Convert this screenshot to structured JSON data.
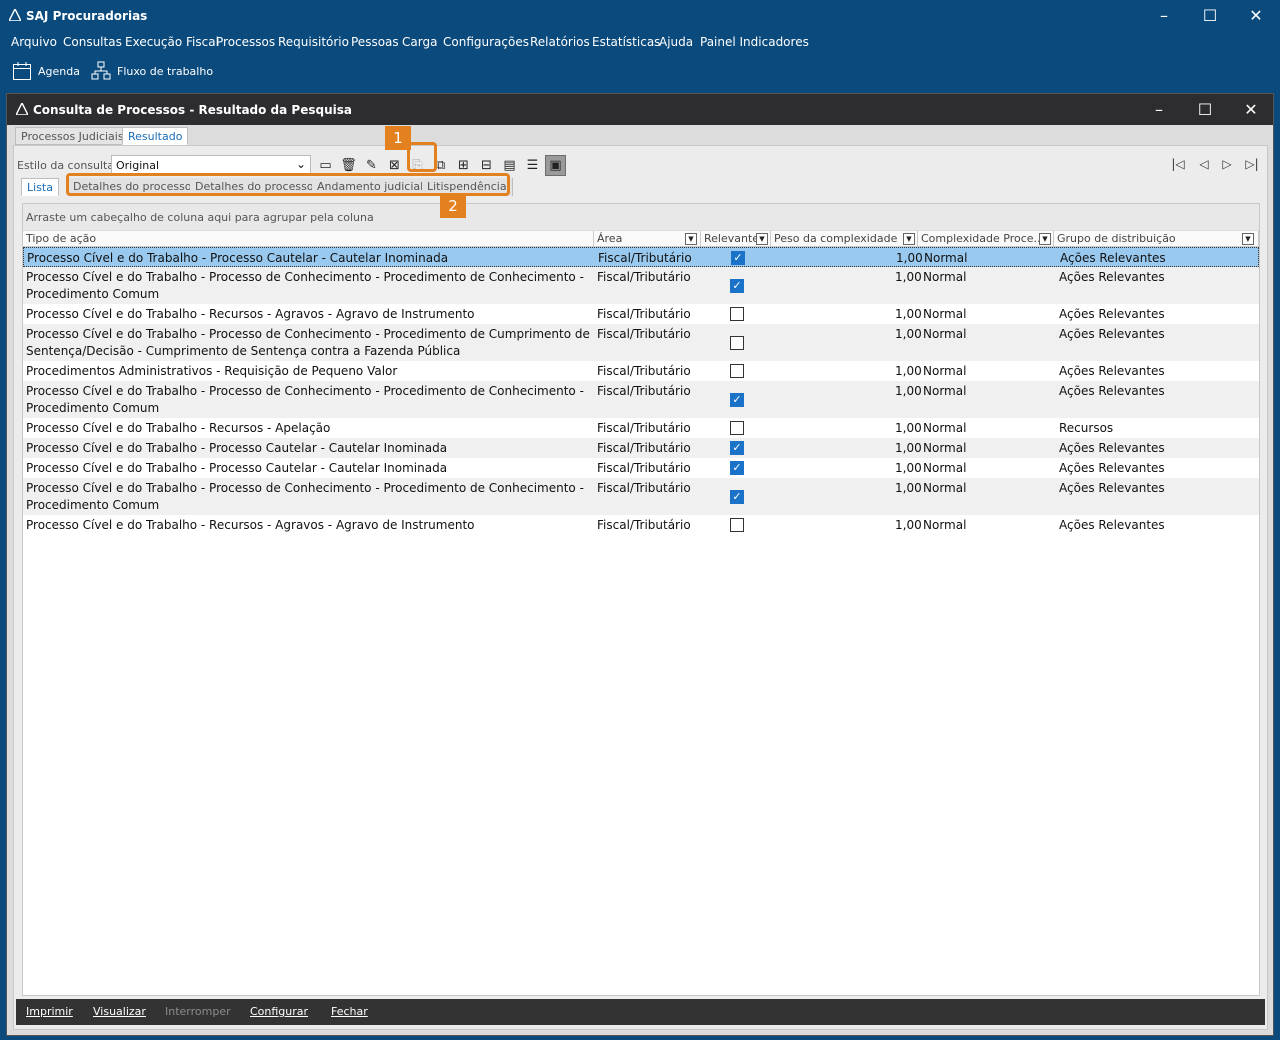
{
  "app": {
    "title": "SAJ Procuradorias"
  },
  "menu": [
    "Arquivo",
    "Consultas",
    "Execução Fiscal",
    "Processos",
    "Requisitório",
    "Pessoas",
    "Carga",
    "Configurações",
    "Relatórios",
    "Estatísticas",
    "Ajuda",
    "Painel Indicadores"
  ],
  "toolbar": {
    "agenda": "Agenda",
    "fluxo": "Fluxo de trabalho"
  },
  "window": {
    "title": "Consulta de Processos - Resultado da Pesquisa"
  },
  "top_tabs": [
    "Processos Judiciais",
    "Resultado"
  ],
  "estilo": {
    "label": "Estilo da consulta",
    "value": "Original"
  },
  "sub_tabs": [
    "Lista",
    "Detalhes do processo",
    "Detalhes do processo",
    "Andamento judicial",
    "Litispendência"
  ],
  "annotations": {
    "badge1": "1",
    "badge2": "2"
  },
  "grid": {
    "group_hint": "Arraste um cabeçalho de coluna aqui para agrupar pela coluna",
    "columns": [
      "Tipo de ação",
      "Área",
      "Relevante",
      "Peso da complexidade",
      "Complexidade Proce...",
      "Grupo de distribuição"
    ],
    "rows": [
      {
        "tipo": "Processo Cível e do Trabalho - Processo Cautelar - Cautelar Inominada",
        "tipo2": "",
        "area": "Fiscal/Tributário",
        "relevante": true,
        "peso": "1,00",
        "complexidade": "Normal",
        "grupo": "Ações Relevantes"
      },
      {
        "tipo": "Processo Cível e do Trabalho - Processo de Conhecimento - Procedimento de Conhecimento -",
        "tipo2": "Procedimento Comum",
        "area": "Fiscal/Tributário",
        "relevante": true,
        "peso": "1,00",
        "complexidade": "Normal",
        "grupo": "Ações Relevantes"
      },
      {
        "tipo": "Processo Cível e do Trabalho - Recursos - Agravos - Agravo de Instrumento",
        "tipo2": "",
        "area": "Fiscal/Tributário",
        "relevante": false,
        "peso": "1,00",
        "complexidade": "Normal",
        "grupo": "Ações Relevantes"
      },
      {
        "tipo": "Processo Cível e do Trabalho - Processo de Conhecimento - Procedimento de Cumprimento de",
        "tipo2": "Sentença/Decisão - Cumprimento de Sentença contra a Fazenda Pública",
        "area": "Fiscal/Tributário",
        "relevante": false,
        "peso": "1,00",
        "complexidade": "Normal",
        "grupo": "Ações Relevantes"
      },
      {
        "tipo": "Procedimentos Administrativos - Requisição de Pequeno Valor",
        "tipo2": "",
        "area": "Fiscal/Tributário",
        "relevante": false,
        "peso": "1,00",
        "complexidade": "Normal",
        "grupo": "Ações Relevantes"
      },
      {
        "tipo": "Processo Cível e do Trabalho - Processo de Conhecimento - Procedimento de Conhecimento -",
        "tipo2": "Procedimento Comum",
        "area": "Fiscal/Tributário",
        "relevante": true,
        "peso": "1,00",
        "complexidade": "Normal",
        "grupo": "Ações Relevantes"
      },
      {
        "tipo": "Processo Cível e do Trabalho - Recursos - Apelação",
        "tipo2": "",
        "area": "Fiscal/Tributário",
        "relevante": false,
        "peso": "1,00",
        "complexidade": "Normal",
        "grupo": "Recursos"
      },
      {
        "tipo": "Processo Cível e do Trabalho - Processo Cautelar - Cautelar Inominada",
        "tipo2": "",
        "area": "Fiscal/Tributário",
        "relevante": true,
        "peso": "1,00",
        "complexidade": "Normal",
        "grupo": "Ações Relevantes"
      },
      {
        "tipo": "Processo Cível e do Trabalho - Processo Cautelar - Cautelar Inominada",
        "tipo2": "",
        "area": "Fiscal/Tributário",
        "relevante": true,
        "peso": "1,00",
        "complexidade": "Normal",
        "grupo": "Ações Relevantes"
      },
      {
        "tipo": "Processo Cível e do Trabalho - Processo de Conhecimento - Procedimento de Conhecimento -",
        "tipo2": "Procedimento Comum",
        "area": "Fiscal/Tributário",
        "relevante": true,
        "peso": "1,00",
        "complexidade": "Normal",
        "grupo": "Ações Relevantes"
      },
      {
        "tipo": "Processo Cível e do Trabalho - Recursos - Agravos - Agravo de Instrumento",
        "tipo2": "",
        "area": "Fiscal/Tributário",
        "relevante": false,
        "peso": "1,00",
        "complexidade": "Normal",
        "grupo": "Ações Relevantes"
      }
    ]
  },
  "bottom": [
    "Imprimir",
    "Visualizar",
    "Interromper",
    "Configurar",
    "Fechar"
  ],
  "colors": {
    "brand": "#0b4a7d",
    "highlight": "#e3801f",
    "selection": "#99c9ef",
    "check": "#1a73c9"
  }
}
